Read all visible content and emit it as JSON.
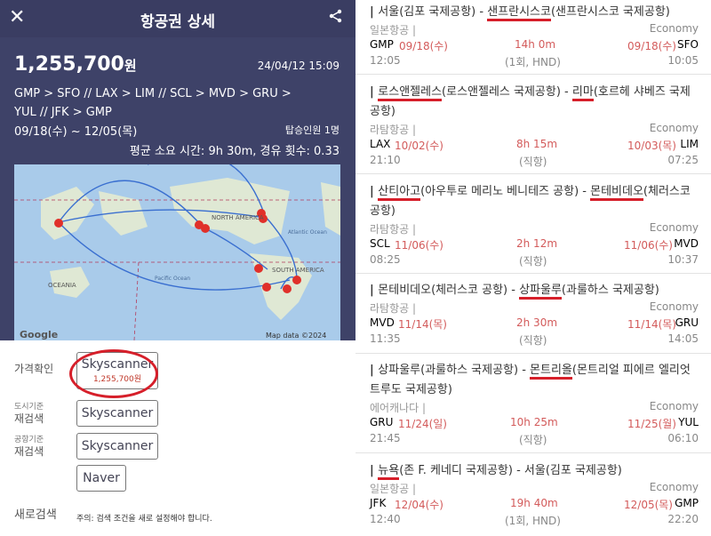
{
  "header": {
    "title": "항공권 상세",
    "close_icon": "close-icon",
    "share_icon": "share-icon"
  },
  "summary": {
    "price": "1,255,700",
    "currency": "원",
    "timestamp": "24/04/12 15:09",
    "route_line1": "GMP  >  SFO  //  LAX  >  LIM  //  SCL  >  MVD  >  GRU  >",
    "route_line2": "YUL  //  JFK  >  GMP",
    "dates": "09/18(수) ~ 12/05(목)",
    "passengers": "탑승인원 1명",
    "avg": "평균 소요 시간: 9h 30m, 경유 횟수: 0.33"
  },
  "map": {
    "labels": [
      "NORTH AMERICA",
      "SOUTH AMERICA",
      "OCEANIA",
      "Atlantic Ocean",
      "Pacific Ocean"
    ],
    "attribution": "Map data ©2024",
    "logo": "Google"
  },
  "actions": {
    "price_check_label": "가격확인",
    "price_check_button": "Skyscanner",
    "price_check_sub": "1,255,700원",
    "city_label_small": "도시기준",
    "city_label": "재검색",
    "city_button": "Skyscanner",
    "airport_label_small": "공항기준",
    "airport_label": "재검색",
    "airport_button": "Skyscanner",
    "naver_button": "Naver",
    "new_search_label": "새로검색",
    "note": "주의: 검색 조건을 새로 설정해야 합니다."
  },
  "segments": [
    {
      "title_a": "서울(김포 국제공항) - ",
      "title_b": "샌프란시스코",
      "title_c": "(샌프란시스코 국제공항)",
      "title_d": "",
      "airline": "일본항공 |",
      "cabin": "Economy",
      "dep_code": "GMP",
      "dep_date": "09/18(수)",
      "duration": "14h 0m",
      "arr_date": "09/18(수)",
      "arr_code": "SFO",
      "dep_time": "12:05",
      "stops": "(1회, HND)",
      "arr_time": "10:05"
    },
    {
      "title_a": "로스앤젤레스",
      "title_b": "(로스앤젤레스 국제공항) - ",
      "title_c": "리마",
      "title_d": "(호르헤 샤베즈 국제공항)",
      "airline": "라탐항공 |",
      "cabin": "Economy",
      "dep_code": "LAX",
      "dep_date": "10/02(수)",
      "duration": "8h 15m",
      "arr_date": "10/03(목)",
      "arr_code": "LIM",
      "dep_time": "21:10",
      "stops": "(직항)",
      "arr_time": "07:25"
    },
    {
      "title_a": "산티아고",
      "title_b": "(아우투로 메리노 베니테즈 공항) - ",
      "title_c": "몬테비데오",
      "title_d": "(체러스코 공항)",
      "airline": "라탐항공 |",
      "cabin": "Economy",
      "dep_code": "SCL",
      "dep_date": "11/06(수)",
      "duration": "2h 12m",
      "arr_date": "11/06(수)",
      "arr_code": "MVD",
      "dep_time": "08:25",
      "stops": "(직항)",
      "arr_time": "10:37"
    },
    {
      "title_a": "몬테비데오(체러스코 공항) - ",
      "title_b": "상파울루",
      "title_c": "(과룰하스 국제공항)",
      "title_d": "",
      "airline": "라탐항공 |",
      "cabin": "Economy",
      "dep_code": "MVD",
      "dep_date": "11/14(목)",
      "duration": "2h 30m",
      "arr_date": "11/14(목)",
      "arr_code": "GRU",
      "dep_time": "11:35",
      "stops": "(직항)",
      "arr_time": "14:05"
    },
    {
      "title_a": "상파울루(과룰하스 국제공항) - ",
      "title_b": "몬트리올",
      "title_c": "(몬트리얼 피에르 엘리엇 트루도 국제공항)",
      "title_d": "",
      "airline": "에어캐나다 |",
      "cabin": "Economy",
      "dep_code": "GRU",
      "dep_date": "11/24(일)",
      "duration": "10h 25m",
      "arr_date": "11/25(월)",
      "arr_code": "YUL",
      "dep_time": "21:45",
      "stops": "(직항)",
      "arr_time": "06:10"
    },
    {
      "title_a": "뉴욕",
      "title_b": "(존 F. 케네디 국제공항) - ",
      "title_c": "서울(김포 국제공항)",
      "title_d": "",
      "airline": "일본항공 |",
      "cabin": "Economy",
      "dep_code": "JFK",
      "dep_date": "12/04(수)",
      "duration": "19h 40m",
      "arr_date": "12/05(목)",
      "arr_code": "GMP",
      "dep_time": "12:40",
      "stops": "(1회, HND)",
      "arr_time": "22:20"
    }
  ]
}
